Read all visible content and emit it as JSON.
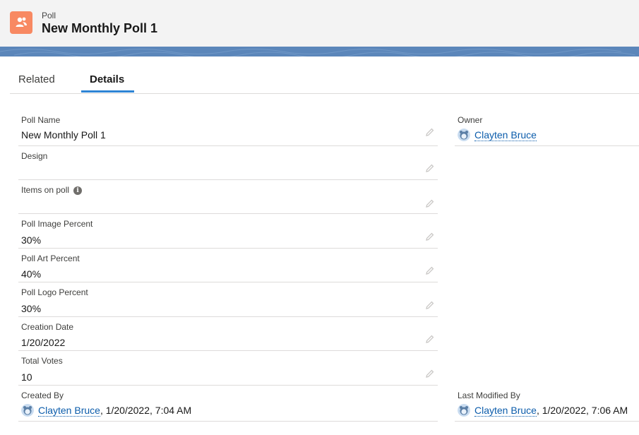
{
  "header": {
    "object_type": "Poll",
    "record_title": "New Monthly Poll 1"
  },
  "tabs": [
    {
      "label": "Related",
      "active": false
    },
    {
      "label": "Details",
      "active": true
    }
  ],
  "fields": {
    "poll_name": {
      "label": "Poll Name",
      "value": "New Monthly Poll 1"
    },
    "design": {
      "label": "Design",
      "value": ""
    },
    "items_on_poll": {
      "label": "Items on poll",
      "value": "",
      "info_icon": "info-icon"
    },
    "poll_image_percent": {
      "label": "Poll Image Percent",
      "value": "30%"
    },
    "poll_art_percent": {
      "label": "Poll Art Percent",
      "value": "40%"
    },
    "poll_logo_percent": {
      "label": "Poll Logo Percent",
      "value": "30%"
    },
    "creation_date": {
      "label": "Creation Date",
      "value": "1/20/2022"
    },
    "total_votes": {
      "label": "Total Votes",
      "value": "10"
    },
    "created_by": {
      "label": "Created By",
      "user": "Clayten Bruce",
      "date": ", 1/20/2022, 7:04 AM"
    },
    "owner": {
      "label": "Owner",
      "user": "Clayten Bruce"
    },
    "last_modified_by": {
      "label": "Last Modified By",
      "user": "Clayten Bruce",
      "date": ", 1/20/2022, 7:06 AM"
    }
  },
  "colors": {
    "accent": "#2e84d5",
    "object_icon": "#f88962",
    "link": "#0b5cab",
    "band": "#5b86ba"
  },
  "icons": {
    "object": "poll-object-icon",
    "edit": "pencil-icon",
    "avatar": "user-avatar-icon"
  }
}
